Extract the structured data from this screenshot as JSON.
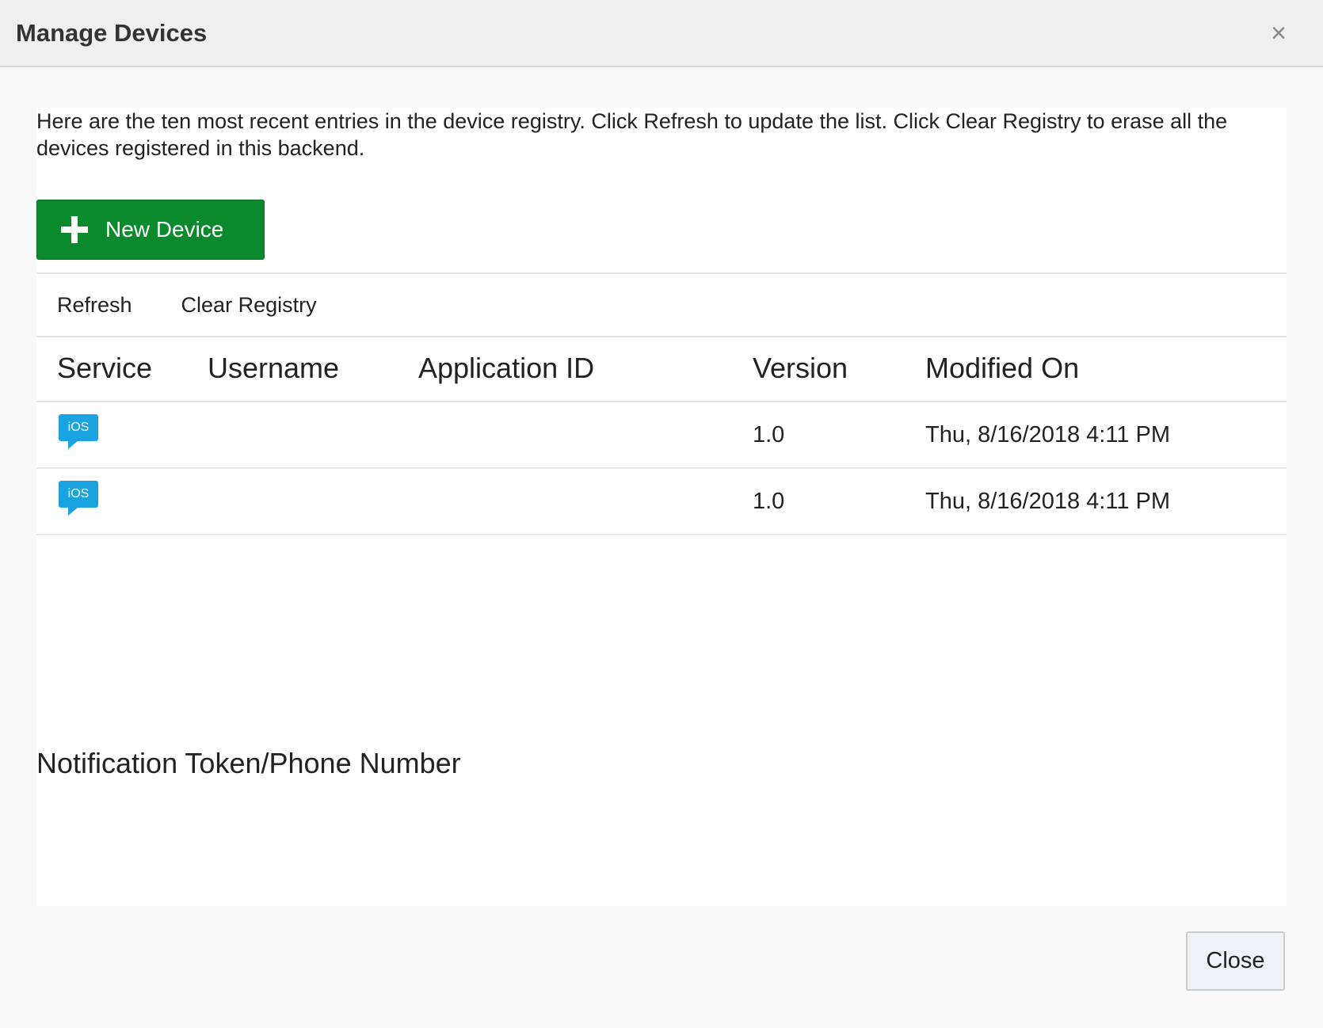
{
  "dialog": {
    "title": "Manage Devices",
    "close_icon": "×"
  },
  "intro_text": "Here are the ten most recent entries in the device registry. Click Refresh to update the list. Click Clear Registry to erase all the devices registered in this backend.",
  "new_device_button": {
    "label": "New Device",
    "icon": "plus-icon"
  },
  "toolbar": {
    "refresh_label": "Refresh",
    "clear_registry_label": "Clear Registry"
  },
  "table": {
    "columns": [
      "Service",
      "Username",
      "Application ID",
      "Version",
      "Modified On"
    ],
    "rows": [
      {
        "service_icon": "iOS",
        "username": "",
        "application_id": "",
        "version": "1.0",
        "modified_on": "Thu, 8/16/2018 4:11 PM"
      },
      {
        "service_icon": "iOS",
        "username": "",
        "application_id": "",
        "version": "1.0",
        "modified_on": "Thu, 8/16/2018 4:11 PM"
      }
    ]
  },
  "notification_label": "Notification Token/Phone Number",
  "footer": {
    "close_label": "Close"
  },
  "colors": {
    "primary_green": "#0a8a2c",
    "ios_blue": "#1aa3e0"
  }
}
